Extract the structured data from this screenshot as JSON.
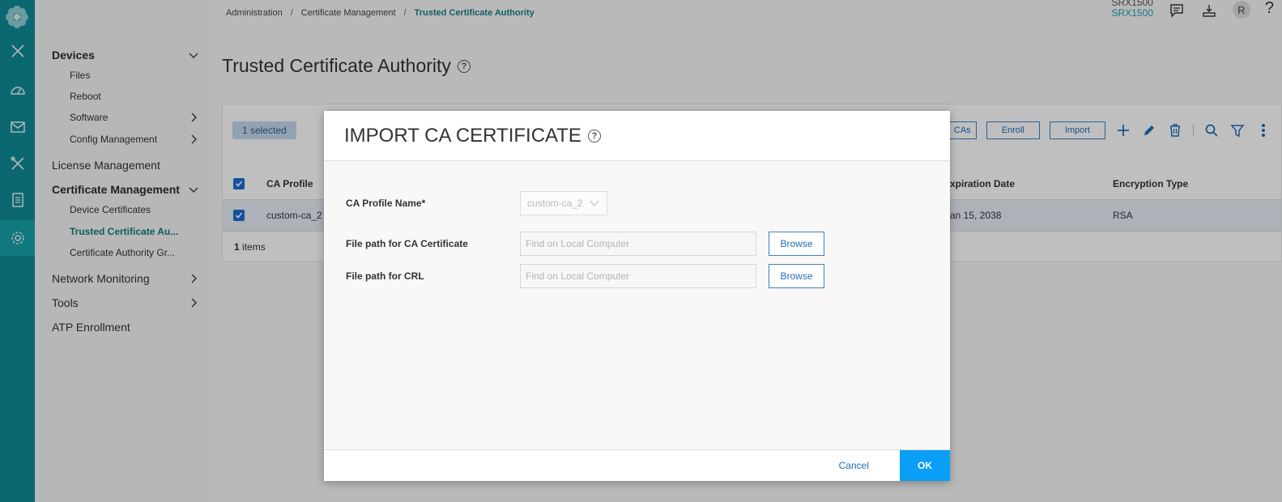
{
  "rail": {
    "icons": [
      "logo-icon",
      "close-icon",
      "dashboard-icon",
      "monitor-icon",
      "tools-icon",
      "reports-icon",
      "settings-icon"
    ]
  },
  "sidebar": {
    "devices": "Devices",
    "files": "Files",
    "reboot": "Reboot",
    "software": "Software",
    "config_management": "Config Management",
    "license_management": "License Management",
    "certificate_management": "Certificate Management",
    "device_certificates": "Device Certificates",
    "trusted_ca": "Trusted Certificate Au...",
    "ca_group": "Certificate Authority Gr...",
    "network_monitoring": "Network Monitoring",
    "tools": "Tools",
    "atp_enrollment": "ATP Enrollment"
  },
  "breadcrumb": {
    "item1": "Administration",
    "sep": "/",
    "item2": "Certificate Management",
    "current": "Trusted Certificate Authority"
  },
  "topbar": {
    "device_line1": "SRX1500",
    "device_line2": "SRX1500",
    "avatar": "R",
    "help": "?"
  },
  "page": {
    "title": "Trusted Certificate Authority",
    "help_icon": "?"
  },
  "grid": {
    "selected": "1 selected",
    "toolbar": {
      "cas_label": "CAs",
      "enroll_label": "Enroll",
      "import_label": "Import"
    },
    "columns": {
      "ca_profile": "CA Profile",
      "expiration": "xpiration Date",
      "encryption": "Encryption Type"
    },
    "rows": [
      {
        "ca_profile": "custom-ca_2",
        "expiration": "an 15, 2038",
        "encryption": "RSA"
      }
    ],
    "footer_count": "1",
    "footer_label": " items"
  },
  "modal": {
    "title": "IMPORT CA CERTIFICATE",
    "help_icon": "?",
    "profile_label": "CA Profile Name*",
    "profile_value": "custom-ca_2",
    "ca_cert_label": "File path for CA Certificate",
    "ca_cert_placeholder": "Find on Local Computer",
    "crl_label": "File path for CRL",
    "crl_placeholder": "Find on Local Computer",
    "browse_label": "Browse",
    "cancel_label": "Cancel",
    "ok_label": "OK"
  },
  "colors": {
    "rail": "#0f8b96",
    "accent": "#127c86",
    "primary_button": "#0a9ff5",
    "link_blue": "#1d6fb8"
  }
}
